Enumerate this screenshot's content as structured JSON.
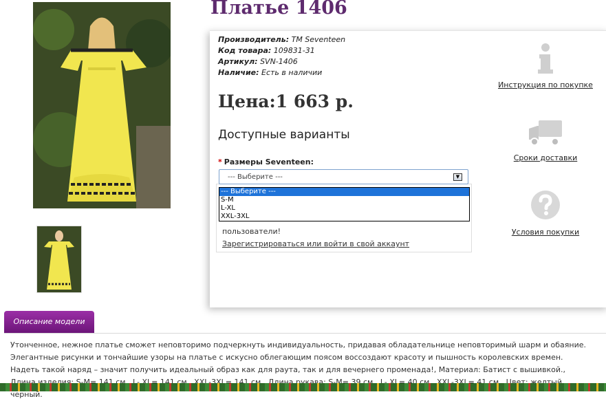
{
  "product": {
    "title": "Платье 1406",
    "meta": [
      {
        "label": "Производитель:",
        "value": "TM Seventeen"
      },
      {
        "label": "Код товара:",
        "value": "109831-31"
      },
      {
        "label": "Артикул:",
        "value": "SVN-1406"
      },
      {
        "label": "Наличие:",
        "value": "Есть в наличии"
      }
    ],
    "price": "Цена:1 663 р."
  },
  "options": {
    "title": "Доступные варианты",
    "required_mark": "*",
    "size_label": "Размеры Seventeen:",
    "select_value": "--- Выберите ---",
    "dropdown_items": [
      "--- Выберите ---",
      "S-M",
      "L-XL",
      "XXL-3XL"
    ]
  },
  "login_notice": {
    "text": "пользователи!",
    "link": "Зарегистрироваться или войти в свой аккаунт"
  },
  "sidebar": {
    "items": [
      {
        "icon": "info-icon",
        "label": "Инструкция по покупке"
      },
      {
        "icon": "truck-icon",
        "label": "Сроки доставки"
      },
      {
        "icon": "question-icon",
        "label": "Условия покупки"
      }
    ]
  },
  "description": {
    "tab_label": "Описание модели",
    "text": "Утонченное, нежное платье сможет неповторимо подчеркнуть индивидуальность, придавая обладательнице неповторимый шарм и обаяние. Элегантные рисунки и тончайшие узоры на платье с искусно облегающим поясом воссоздают красоту и пышность королевских времен. Надеть такой наряд – значит получить идеальный образ как для раута, так и для вечернего променада!, Материал: Батист с вышивкой., Длина изделия: S-M= 141 см., L- XL= 141 см., XXL-3XL= 141 см., Длина рукава: S-M= 39 см., L- XL= 40 см., XXL-3XL= 41 см., Цвет: желтый, черный."
  },
  "colors": {
    "title": "#5e2b6e",
    "tab": "#8a2596",
    "dress": "#f1e64f"
  }
}
